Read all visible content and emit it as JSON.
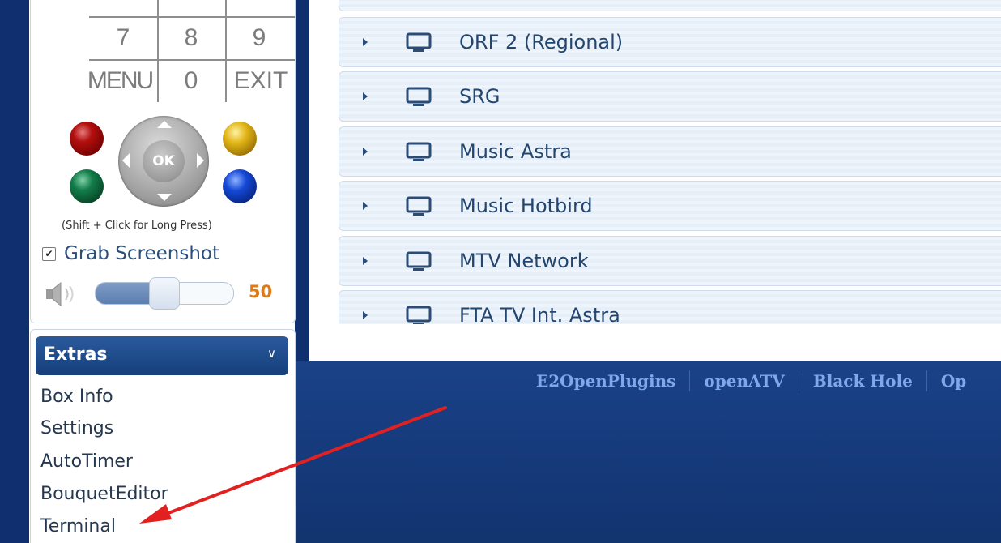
{
  "remote": {
    "keys": [
      "7",
      "8",
      "9",
      "MENU",
      "0",
      "EXIT"
    ],
    "ok_label": "OK",
    "long_press_hint": "(Shift + Click for Long Press)",
    "grab_screenshot_label": "Grab Screenshot",
    "grab_screenshot_checked": true,
    "volume": 50,
    "volume_label": "50",
    "colors": {
      "red": "#b40f0f",
      "green": "#137d4a",
      "yellow": "#e2b618",
      "blue": "#1448d6",
      "accent": "#e07a17"
    }
  },
  "extras": {
    "title": "Extras",
    "items": [
      {
        "label": "Box Info"
      },
      {
        "label": "Settings"
      },
      {
        "label": "AutoTimer"
      },
      {
        "label": "BouquetEditor"
      },
      {
        "label": "Terminal"
      }
    ]
  },
  "channels": {
    "icon": "tv-icon",
    "items": [
      {
        "label": "ORF 2 (Regional)"
      },
      {
        "label": "SRG"
      },
      {
        "label": "Music Astra"
      },
      {
        "label": "Music Hotbird"
      },
      {
        "label": "MTV Network"
      },
      {
        "label": "FTA TV Int. Astra"
      }
    ]
  },
  "footer": {
    "links": [
      {
        "label": "E2OpenPlugins"
      },
      {
        "label": "openATV"
      },
      {
        "label": "Black Hole"
      },
      {
        "label": "Op"
      }
    ]
  },
  "annotation": {
    "arrow_color": "#e32020",
    "points_to": "Terminal"
  }
}
